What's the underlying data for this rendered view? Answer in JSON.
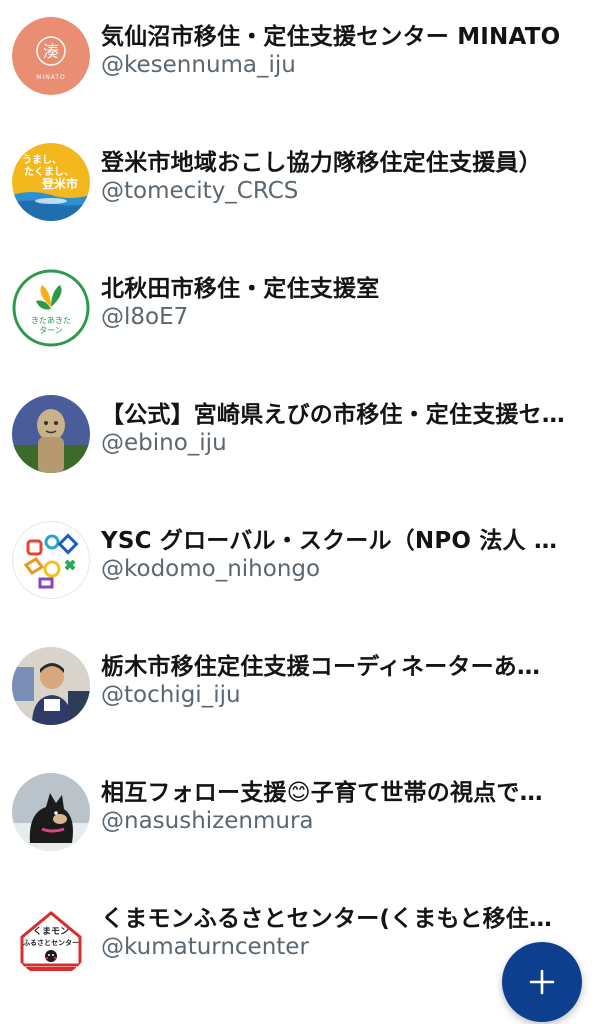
{
  "accounts": [
    {
      "name": "気仙沼市移住・定住支援センター MINATO",
      "handle": "@kesennuma_iju",
      "avatar_icon": "minato-logo-icon",
      "avatar_bg": "#e98e72",
      "logo_char": "湊",
      "logo_caption": "MINATO"
    },
    {
      "name": "登米市地域おこし協力隊移住定住支援員）",
      "handle": "@tomecity_CRCS",
      "avatar_icon": "tome-rice-logo-icon",
      "avatar_bg": "#f2b81d",
      "logo_lines": [
        "うまし、",
        "たくまし、",
        "登米市"
      ]
    },
    {
      "name": "北秋田市移住・定住支援室",
      "handle": "@l8oE7",
      "avatar_icon": "kitaakita-turn-logo-icon",
      "avatar_bg": "#ffffff",
      "logo_lines": [
        "きたあきた",
        "ターン"
      ]
    },
    {
      "name": "【公式】宮崎県えびの市移住・定住支援セ…",
      "handle": "@ebino_iju",
      "avatar_icon": "statue-photo-icon",
      "avatar_bg": "#4a5d9a"
    },
    {
      "name": "YSC グローバル・スクール（NPO 法人 青…",
      "handle": "@kodomo_nihongo",
      "avatar_icon": "colorful-shapes-logo-icon",
      "avatar_bg": "#ffffff"
    },
    {
      "name": "栃木市移住定住支援コーディネーターあ…",
      "handle": "@tochigi_iju",
      "avatar_icon": "person-photo-icon",
      "avatar_bg": "#d8d4cc"
    },
    {
      "name": "相互フォロー支援😊子育て世帯の視点で…",
      "handle": "@nasushizenmura",
      "avatar_icon": "dog-photo-icon",
      "avatar_bg": "#b9c3c9"
    },
    {
      "name": "くまモンふるさとセンター(くまもと移住…",
      "handle": "@kumaturncenter",
      "avatar_icon": "kumamon-center-logo-icon",
      "avatar_bg": "#ffffff",
      "logo_lines": [
        "くまモン",
        "ふるさとセンター"
      ]
    }
  ],
  "fab": {
    "icon": "plus-icon",
    "color": "#0e3f8f"
  }
}
